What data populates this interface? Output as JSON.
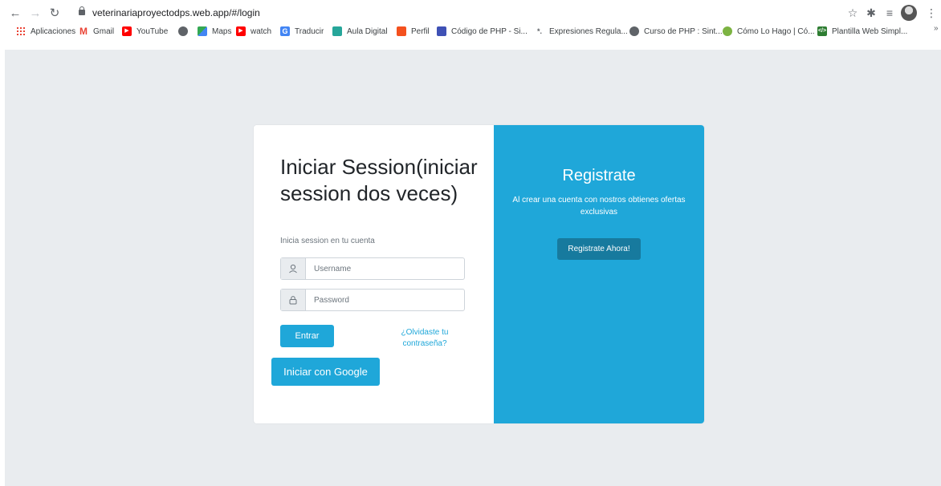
{
  "browser": {
    "url": "veterinariaproyectodps.web.app/#/login",
    "bookmarks": [
      {
        "label": "Aplicaciones",
        "icon": "apps-grid-icon",
        "color": "#ea4335"
      },
      {
        "label": "Gmail",
        "icon": "gmail-icon",
        "color": "#ea4335"
      },
      {
        "label": "YouTube",
        "icon": "youtube-icon",
        "color": "#ff0000"
      },
      {
        "label": "",
        "icon": "globe-icon",
        "color": "#5f6368"
      },
      {
        "label": "Maps",
        "icon": "maps-icon",
        "color": "#34a853"
      },
      {
        "label": "watch",
        "icon": "youtube-icon",
        "color": "#ff0000"
      },
      {
        "label": "Traducir",
        "icon": "translate-icon",
        "color": "#4285f4"
      },
      {
        "label": "Aula Digital",
        "icon": "aula-digital-icon",
        "color": "#26a69a"
      },
      {
        "label": "Perfil",
        "icon": "profile-icon",
        "color": "#f4511e"
      },
      {
        "label": "Código de PHP - Si...",
        "icon": "php-icon",
        "color": "#3f51b5"
      },
      {
        "label": "Expresiones Regula...",
        "icon": "regex-icon",
        "color": "#5f6368"
      },
      {
        "label": "Curso de PHP : Sint...",
        "icon": "globe-icon",
        "color": "#5f6368"
      },
      {
        "label": "Cómo Lo Hago | Có...",
        "icon": "howto-icon",
        "color": "#7cb342"
      },
      {
        "label": "Plantilla Web Simpl...",
        "icon": "template-icon",
        "color": "#2e7d32"
      }
    ],
    "overflow": "»"
  },
  "login": {
    "title": "Iniciar Session(iniciar session dos veces)",
    "subtitle": "Inicia session en tu cuenta",
    "username_placeholder": "Username",
    "password_placeholder": "Password",
    "submit_label": "Entrar",
    "forgot_label": "¿Olvidaste tu contraseña?",
    "google_label": "Iniciar con Google"
  },
  "register": {
    "title": "Registrate",
    "description": "Al crear una cuenta con nostros obtienes ofertas exclusivas",
    "button_label": "Registrate Ahora!"
  },
  "colors": {
    "accent": "#1fa7d9",
    "accent_dark": "#177a9e",
    "page_bg": "#e9ecef"
  }
}
